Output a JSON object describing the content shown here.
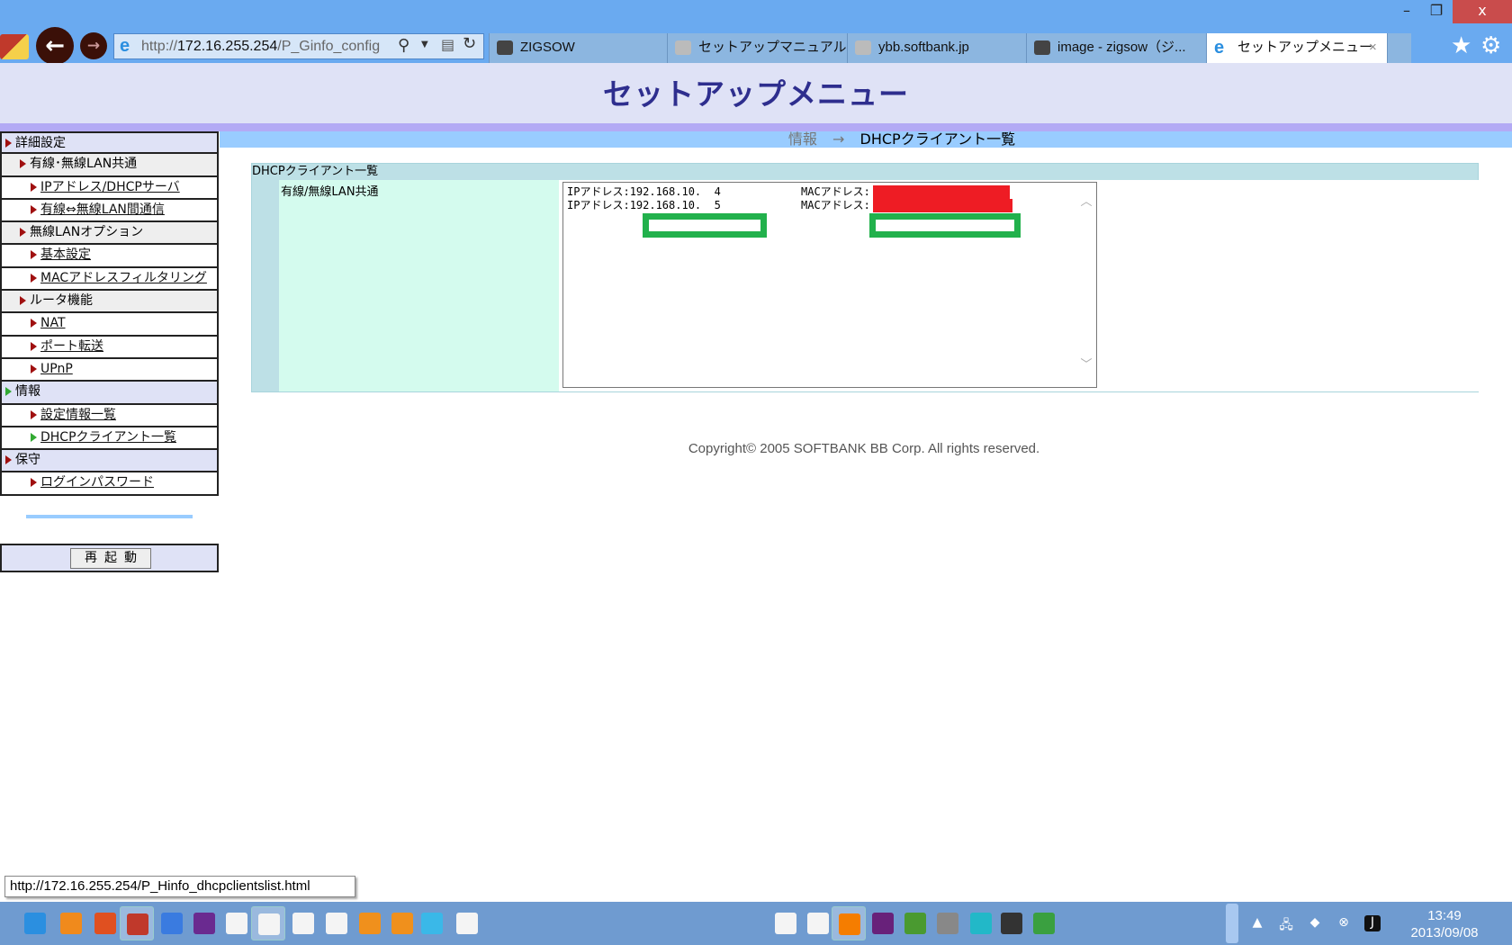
{
  "browser": {
    "address_scheme": "http://",
    "address_host": "172.16.255.254",
    "address_path": "/P_Ginfo_config",
    "tabs": [
      {
        "label": "ZIGSOW",
        "icon": "puzzle-icon"
      },
      {
        "label": "セットアップマニュアル（Y...",
        "icon": "page-icon"
      },
      {
        "label": "ybb.softbank.jp",
        "icon": "page-icon"
      },
      {
        "label": "image - zigsow（ジ...",
        "icon": "puzzle-icon"
      },
      {
        "label": "セットアップメニュー",
        "icon": "ie-icon",
        "active": true
      }
    ],
    "close_tab": "×",
    "window_close": "x"
  },
  "page": {
    "title": "セットアップメニュー",
    "breadcrumb": {
      "parent": "情報",
      "arrow": "→",
      "current": "DHCPクライアント一覧"
    }
  },
  "sidebar": {
    "items": [
      {
        "label": "詳細設定",
        "level": 0
      },
      {
        "label": "有線･無線LAN共通",
        "level": 1
      },
      {
        "label": "IPアドレス/DHCPサーバ",
        "level": 2
      },
      {
        "label": "有線⇔無線LAN間通信",
        "level": 2
      },
      {
        "label": "無線LANオプション",
        "level": 1
      },
      {
        "label": "基本設定",
        "level": 2
      },
      {
        "label": "MACアドレスフィルタリング",
        "level": 2
      },
      {
        "label": "ルータ機能",
        "level": 1
      },
      {
        "label": "NAT",
        "level": 2
      },
      {
        "label": "ポート転送",
        "level": 2
      },
      {
        "label": "UPnP",
        "level": 2
      },
      {
        "label": "情報",
        "level": 0,
        "active": true
      },
      {
        "label": "設定情報一覧",
        "level": 2
      },
      {
        "label": "DHCPクライアント一覧",
        "level": 2,
        "active": true
      },
      {
        "label": "保守",
        "level": 0
      },
      {
        "label": "ログインパスワード",
        "level": 2
      }
    ],
    "restart_label": "再起動"
  },
  "content": {
    "section_title": "DHCPクライアント一覧",
    "row_label": "有線/無線LAN共通",
    "clients": [
      {
        "ip_label": "IPアドレス:",
        "ip": "192.168.10.  4",
        "mac_label": "MACアドレス:"
      },
      {
        "ip_label": "IPアドレス:",
        "ip": "192.168.10.  5",
        "mac_label": "MACアドレス:"
      }
    ]
  },
  "footer": {
    "copyright": "Copyright© 2005 SOFTBANK BB Corp. All rights reserved."
  },
  "status_bar": {
    "url": "http://172.16.255.254/P_Hinfo_dhcpclientslist.html"
  },
  "taskbar": {
    "apps": [
      {
        "name": "ie",
        "color": "#2b8fe0"
      },
      {
        "name": "media-player",
        "color": "#f08a1c"
      },
      {
        "name": "store",
        "color": "#e05020"
      },
      {
        "name": "puzzle",
        "color": "#c0392b",
        "active": true
      },
      {
        "name": "google",
        "color": "#3a7be0"
      },
      {
        "name": "windows",
        "color": "#6a2a90"
      },
      {
        "name": "app-red",
        "color": "#f4f4f4"
      },
      {
        "name": "youtube",
        "color": "#f4f4f4",
        "active": true
      },
      {
        "name": "yahoo",
        "color": "#f4f4f4"
      },
      {
        "name": "green-app",
        "color": "#f4f4f4"
      },
      {
        "name": "bing",
        "color": "#f0901c"
      },
      {
        "name": "bing-2",
        "color": "#f0901c"
      },
      {
        "name": "windows-blue",
        "color": "#3ab8e8"
      },
      {
        "name": "mail",
        "color": "#f4f4f4"
      },
      {
        "name": "goo",
        "color": "#f4f4f4"
      },
      {
        "name": "blue-app",
        "color": "#f4f4f4"
      },
      {
        "name": "blogger",
        "color": "#f57d00",
        "active": true
      },
      {
        "name": "visual-studio",
        "color": "#68217a"
      },
      {
        "name": "windows-orb",
        "color": "#4a9a30"
      },
      {
        "name": "microphone",
        "color": "#888888"
      },
      {
        "name": "cyan-app",
        "color": "#22b8c8"
      },
      {
        "name": "pen",
        "color": "#333333"
      },
      {
        "name": "green-character",
        "color": "#3aa040"
      }
    ],
    "time": "13:49",
    "date": "2013/09/08"
  },
  "colors": {
    "redaction": "#ee1c24",
    "highlight": "#22b14c",
    "title": "#2e2e8e"
  }
}
